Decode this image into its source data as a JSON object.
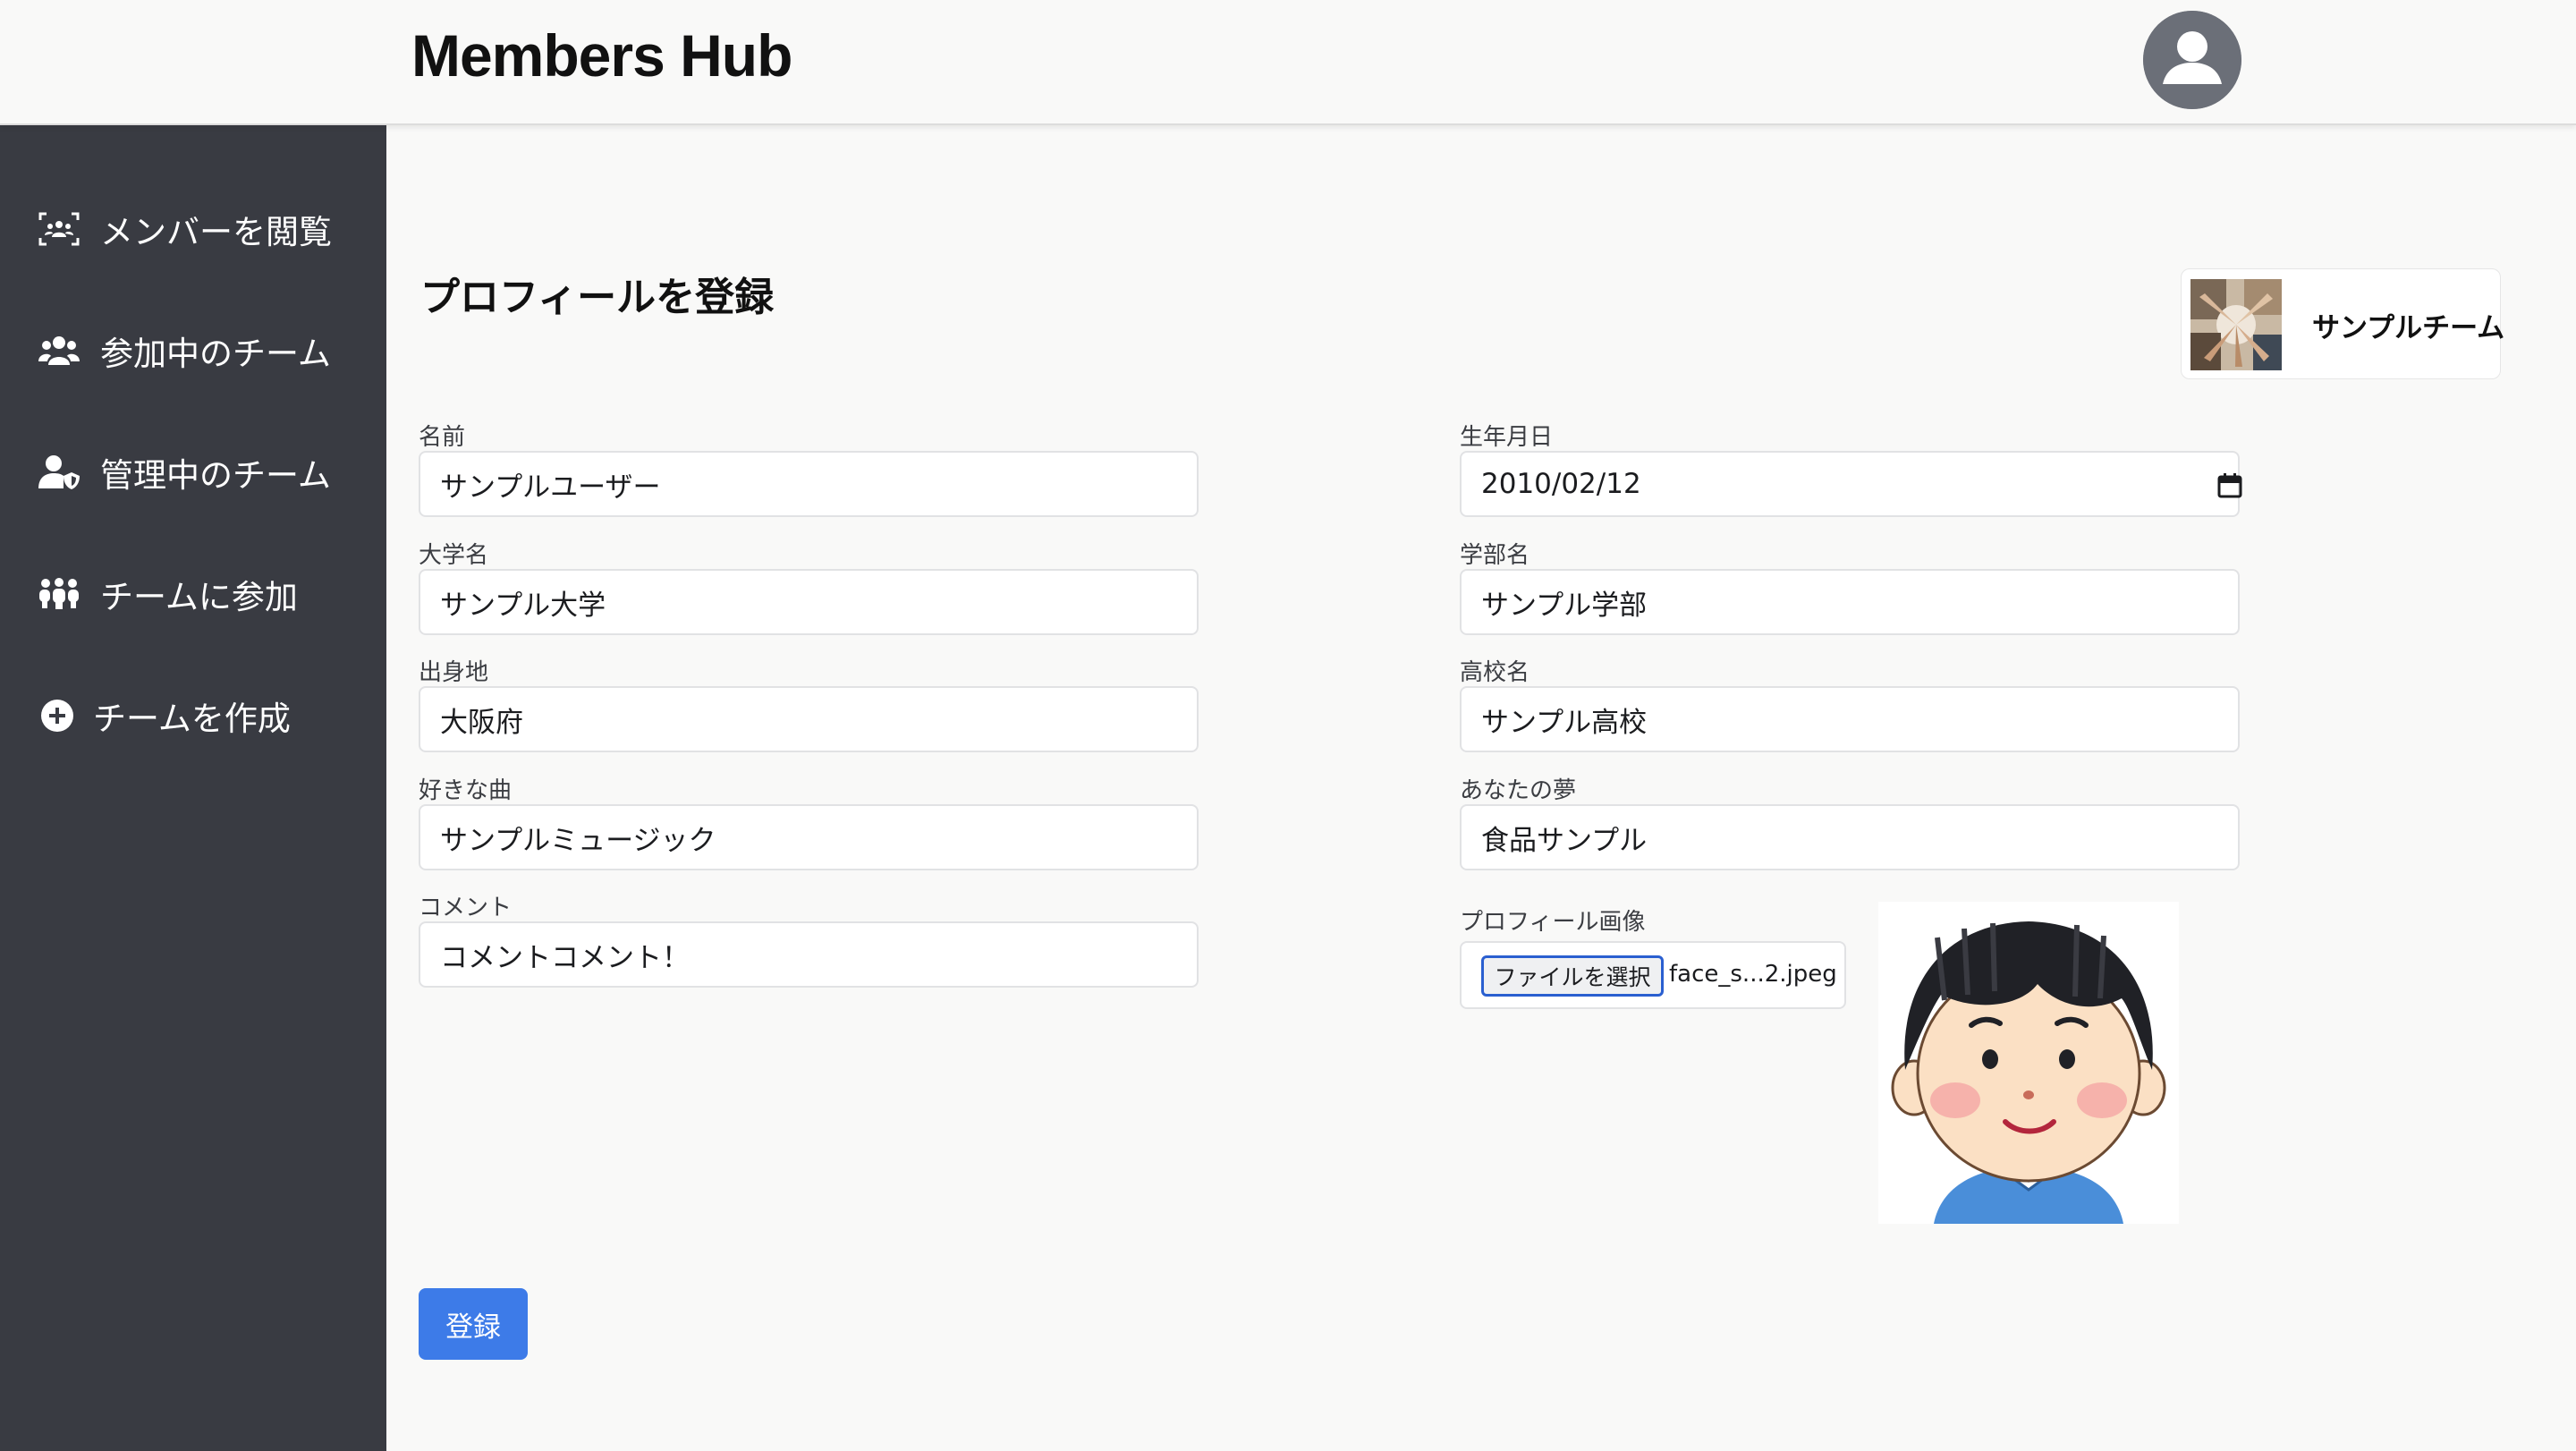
{
  "header": {
    "app_title": "Members Hub"
  },
  "sidebar": {
    "items": [
      {
        "label": "メンバーを閲覧",
        "icon": "members-scan-icon"
      },
      {
        "label": "参加中のチーム",
        "icon": "team-icon"
      },
      {
        "label": "管理中のチーム",
        "icon": "user-shield-icon"
      },
      {
        "label": "チームに参加",
        "icon": "people-group-icon"
      },
      {
        "label": "チームを作成",
        "icon": "plus-circle-icon"
      }
    ]
  },
  "main": {
    "page_title": "プロフィールを登録",
    "team_card": {
      "name": "サンプルチーム"
    },
    "form": {
      "name": {
        "label": "名前",
        "value": "サンプルユーザー"
      },
      "birthday": {
        "label": "生年月日",
        "value": "2010/02/12"
      },
      "university": {
        "label": "大学名",
        "value": "サンプル大学"
      },
      "faculty": {
        "label": "学部名",
        "value": "サンプル学部"
      },
      "hometown": {
        "label": "出身地",
        "value": "大阪府"
      },
      "high_school": {
        "label": "高校名",
        "value": "サンプル高校"
      },
      "favorite_song": {
        "label": "好きな曲",
        "value": "サンプルミュージック"
      },
      "dream": {
        "label": "あなたの夢",
        "value": "食品サンプル"
      },
      "comment": {
        "label": "コメント",
        "value": "コメントコメント！"
      },
      "profile_image": {
        "label": "プロフィール画像",
        "button_label": "ファイルを選択",
        "file_name": "face_s...2.jpeg"
      }
    },
    "submit_label": "登録"
  },
  "colors": {
    "sidebar_bg": "#393b42",
    "page_bg": "#f9f9f8",
    "accent": "#3d7be8",
    "avatar": "#6b6f78"
  }
}
